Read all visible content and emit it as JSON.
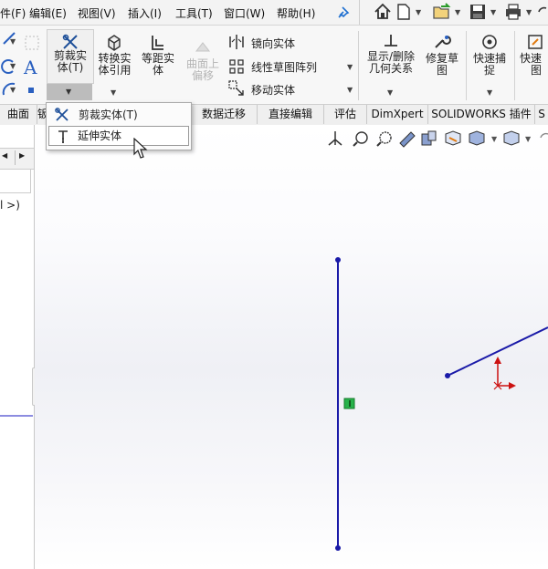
{
  "menubar": {
    "items": [
      {
        "label": "件(F)"
      },
      {
        "label": "编辑(E)"
      },
      {
        "label": "视图(V)"
      },
      {
        "label": "插入(I)"
      },
      {
        "label": "工具(T)"
      },
      {
        "label": "窗口(W)"
      },
      {
        "label": "帮助(H)"
      }
    ]
  },
  "ribbon": {
    "trim": {
      "line1": "剪裁实",
      "line2": "体(T)"
    },
    "convert": {
      "line1": "转换实",
      "line2": "体引用"
    },
    "offset": {
      "line1": "等距实",
      "line2": "体"
    },
    "surface_offset": {
      "line1": "曲面上",
      "line2": "偏移"
    },
    "mirror": "镜向实体",
    "linear_pattern": "线性草图阵列",
    "move": "移动实体",
    "show_relations": {
      "line1": "显示/删除",
      "line2": "几何关系"
    },
    "repair": {
      "line1": "修复草",
      "line2": "图"
    },
    "quick_snaps": {
      "line1": "快速捕",
      "line2": "捉"
    },
    "quick_view": {
      "line1": "快速",
      "line2": "图"
    }
  },
  "tabs": [
    {
      "label": "曲面"
    },
    {
      "label": "钣"
    },
    {
      "label": "数据迁移"
    },
    {
      "label": "直接编辑"
    },
    {
      "label": "评估"
    },
    {
      "label": "DimXpert"
    },
    {
      "label": "SOLIDWORKS 插件"
    },
    {
      "label": "S"
    }
  ],
  "dropdown": {
    "items": [
      {
        "label": "剪裁实体(T)"
      },
      {
        "label": "延伸实体"
      }
    ]
  },
  "left_panel": {
    "text": "l >)"
  },
  "colors": {
    "sketch_line": "#1a1aa8",
    "constraint_badge": "#27b24a",
    "origin": "#cc1111"
  },
  "icons": [
    "home-icon",
    "new-file-icon",
    "open-icon",
    "save-icon",
    "print-icon",
    "pin-icon",
    "trim-icon",
    "convert-icon",
    "offset-icon",
    "mirror-icon",
    "pattern-icon",
    "move-icon",
    "relations-icon",
    "repair-icon",
    "snap-icon"
  ]
}
